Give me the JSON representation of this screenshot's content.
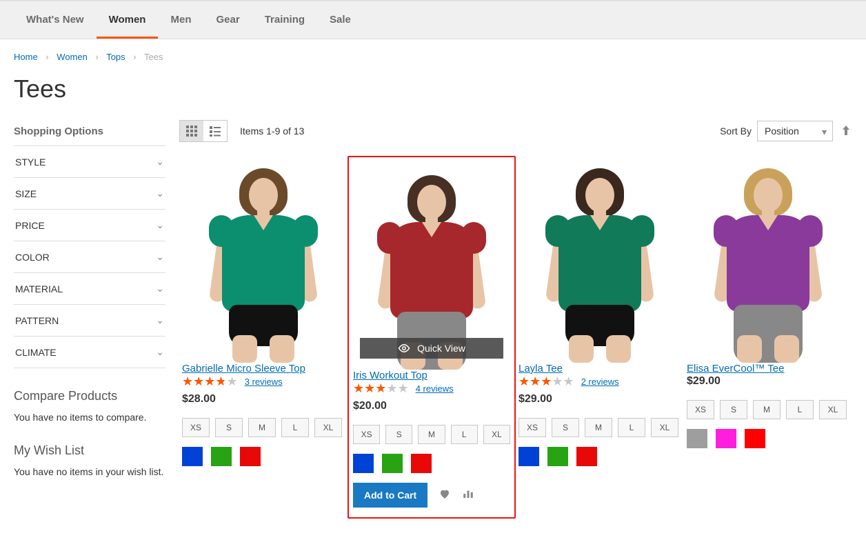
{
  "nav": [
    {
      "label": "What's New",
      "active": false
    },
    {
      "label": "Women",
      "active": true
    },
    {
      "label": "Men",
      "active": false
    },
    {
      "label": "Gear",
      "active": false
    },
    {
      "label": "Training",
      "active": false
    },
    {
      "label": "Sale",
      "active": false
    }
  ],
  "breadcrumb": {
    "home": "Home",
    "women": "Women",
    "tops": "Tops",
    "current": "Tees"
  },
  "page_title": "Tees",
  "sidebar": {
    "shopping_options": "Shopping Options",
    "filters": [
      {
        "label": "STYLE"
      },
      {
        "label": "SIZE"
      },
      {
        "label": "PRICE"
      },
      {
        "label": "COLOR"
      },
      {
        "label": "MATERIAL"
      },
      {
        "label": "PATTERN"
      },
      {
        "label": "CLIMATE"
      }
    ],
    "compare_title": "Compare Products",
    "compare_msg": "You have no items to compare.",
    "wishlist_title": "My Wish List",
    "wishlist_msg": "You have no items in your wish list."
  },
  "toolbar": {
    "amount": "Items 1-9 of 13",
    "sort_by_label": "Sort By",
    "sort_value": "Position"
  },
  "quick_view": "Quick View",
  "add_to_cart": "Add to Cart",
  "products": [
    {
      "name": "Gabrielle Micro Sleeve Top",
      "rating_pct": 75,
      "reviews": "3 reviews",
      "price": "$28.00",
      "sizes": [
        "XS",
        "S",
        "M",
        "L",
        "XL"
      ],
      "colors": [
        "#0042d6",
        "#28a313",
        "#e80808"
      ],
      "shirt": "#0b8f6e",
      "hair": "#6b4a2a",
      "pants": false,
      "hand_hip": false,
      "highlight": false,
      "show_actions": false
    },
    {
      "name": "Iris Workout Top",
      "rating_pct": 58,
      "reviews": "4 reviews",
      "price": "$20.00",
      "sizes": [
        "XS",
        "S",
        "M",
        "L",
        "XL"
      ],
      "colors": [
        "#0042d6",
        "#28a313",
        "#e80808"
      ],
      "shirt": "#a6272c",
      "hair": "#472f24",
      "pants": true,
      "hand_hip": false,
      "highlight": true,
      "show_actions": true,
      "quick_view": true
    },
    {
      "name": "Layla Tee",
      "rating_pct": 60,
      "reviews": "2 reviews",
      "price": "$29.00",
      "sizes": [
        "XS",
        "S",
        "M",
        "L",
        "XL"
      ],
      "colors": [
        "#0042d6",
        "#28a313",
        "#e80808"
      ],
      "shirt": "#117a58",
      "hair": "#3a281d",
      "pants": false,
      "hand_hip": true,
      "highlight": false,
      "show_actions": false
    },
    {
      "name": "Elisa EverCool™ Tee",
      "rating_pct": 0,
      "reviews": "",
      "price": "$29.00",
      "sizes": [
        "XS",
        "S",
        "M",
        "L",
        "XL"
      ],
      "colors": [
        "#9e9e9e",
        "#ff1edc",
        "#ff0000"
      ],
      "shirt": "#8a3a9b",
      "hair": "#caa15a",
      "pants": true,
      "hand_hip": false,
      "highlight": false,
      "show_actions": false
    }
  ]
}
